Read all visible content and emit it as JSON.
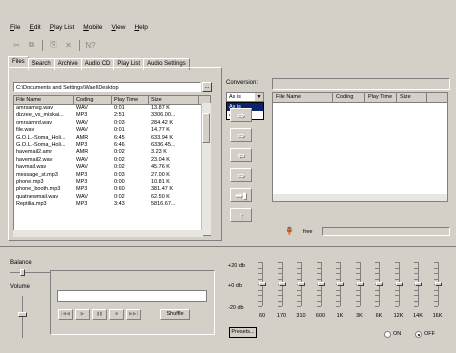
{
  "menu": [
    "File",
    "Edit",
    "Play List",
    "Mobile",
    "View",
    "Help"
  ],
  "toolbar": {
    "icons": [
      "cut-icon",
      "copy-icon",
      "paste-icon",
      "close-icon",
      "help-icon"
    ],
    "labels": [
      "✂",
      "⧉",
      "⎘",
      "✕",
      "N?"
    ]
  },
  "tabs": [
    "Files",
    "Search",
    "Archive",
    "Audio CD",
    "Play List",
    "Audio Settings"
  ],
  "active_tab": 0,
  "path": "C:\\Documents and Settings\\Wael\\Desktop",
  "browse_label": "...",
  "file_columns": [
    "File Name",
    "Coding",
    "Play Time",
    "Size"
  ],
  "files": [
    [
      "amrsamsg.wav",
      "WAV",
      "0:01",
      "13.87 K"
    ],
    [
      "dizzee_vs_miskai...",
      "MP3",
      "2:51",
      "3306.00..."
    ],
    [
      "omrsamrd.wav",
      "WAV",
      "0:03",
      "284.42 K"
    ],
    [
      "file.wav",
      "WAV",
      "0:01",
      "14.77 K"
    ],
    [
      "G.O.L.-Soma_Holi...",
      "AMR",
      "6:45",
      "633.94 K"
    ],
    [
      "G.O.L.-Soma_Holi...",
      "MP3",
      "6:46",
      "6336.45..."
    ],
    [
      "havemail2.amr",
      "AMR",
      "0:02",
      "3.23 K"
    ],
    [
      "havemail2.wav",
      "WAV",
      "0:02",
      "23.04 K"
    ],
    [
      "havmail.wav",
      "WAV",
      "0:02",
      "45.76 K"
    ],
    [
      "message_st.mp3",
      "MP3",
      "0:03",
      "27.00 K"
    ],
    [
      "phone.mp3",
      "MP3",
      "0:00",
      "10.81 K"
    ],
    [
      "phone_booth.mp3",
      "MP3",
      "0:60",
      "381.47 K"
    ],
    [
      "quatnewmail.wav",
      "WAV",
      "0:02",
      "62.50 K"
    ],
    [
      "Reptilia.mp3",
      "MP3",
      "3:43",
      "5816.67..."
    ]
  ],
  "conversion": {
    "label": "Conversion:",
    "selected": "As is",
    "options": [
      "As is",
      "AMR"
    ],
    "arrow": "▼"
  },
  "arrow_buttons": [
    "⇨",
    "⇨",
    "⇦",
    "⇨",
    "➡▮",
    "↑"
  ],
  "playlist_columns": [
    "File Name",
    "Coding",
    "Play Time",
    "Size"
  ],
  "free_label": "free",
  "free_icon": "🏺",
  "balance_label": "Balance",
  "volume_label": "Volume",
  "player_controls": [
    "|◀◀",
    "▶",
    "▮▮",
    "■",
    "▶▶|"
  ],
  "shuffle_label": "Shuffle",
  "eq_scale": [
    "+20 db",
    "+0 db",
    "-20 db"
  ],
  "eq_freqs": [
    "60",
    "170",
    "310",
    "600",
    "1K",
    "3K",
    "6K",
    "12K",
    "14K",
    "16K"
  ],
  "eq_levels_db": [
    0,
    0,
    0,
    0,
    0,
    0,
    0,
    0,
    0,
    0
  ],
  "presets_label": "Presets...",
  "radio": {
    "on_label": "ON",
    "off_label": "OFF",
    "selected": "off"
  }
}
